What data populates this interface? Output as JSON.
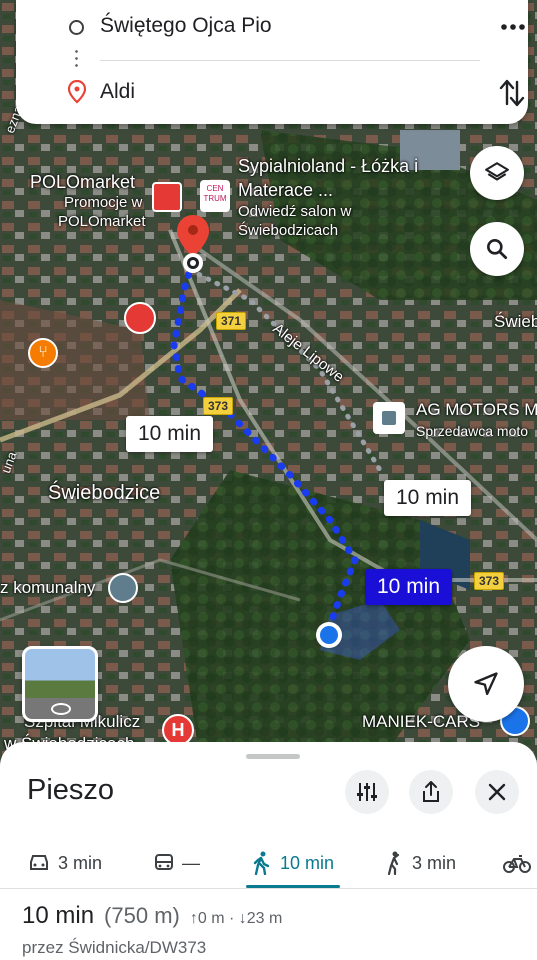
{
  "directions": {
    "origin": "Świętego Ojca Pio",
    "destination": "Aldi"
  },
  "map": {
    "places": {
      "polomarket_name": "POLOmarket",
      "polomarket_sub1": "Promocje w",
      "polomarket_sub2": "POLOmarket",
      "sypialnioland_1": "Sypialnioland - Łóżka i",
      "sypialnioland_2": "Materace ...",
      "sypialnioland_sub1": "Odwiedź salon w",
      "sypialnioland_sub2": "Świebodzicach",
      "centrum_logo": "CEN TRUM",
      "aleje": "Aleje Lipowe",
      "ag_motors": "AG MOTORS M",
      "ag_motors_sub": "Sprzedawca moto",
      "swiebodzice": "Świebodzice",
      "swieb_right": "Świeb",
      "komunalny": "z komunalny",
      "szpital_1": "Szpital Mikulicz",
      "szpital_2": "w Świebodzicach",
      "maniek": "MANIEK-CARS",
      "una": "una",
      "ezna": "ezna"
    },
    "roads": [
      "371",
      "373",
      "373"
    ],
    "time_bubbles": [
      "10 min",
      "10 min",
      "10 min"
    ],
    "colors": {
      "route": "#1a3cf0",
      "active_bubble": "#1a0fd6",
      "pin": "#ea4335"
    }
  },
  "sheet": {
    "title": "Pieszo",
    "modes": [
      {
        "icon": "car-icon",
        "label": "3 min"
      },
      {
        "icon": "transit-icon",
        "label": "—"
      },
      {
        "icon": "walk-icon",
        "label": "10 min",
        "active": true
      },
      {
        "icon": "rideshare-icon",
        "label": "3 min"
      },
      {
        "icon": "bike-icon",
        "label": ""
      }
    ],
    "summary": {
      "duration": "10 min",
      "distance": "(750 m)",
      "elevation_up": "0 m",
      "elevation_down": "23 m",
      "elevation_sep": "·",
      "via": "przez Świdnicka/DW373"
    },
    "accent": "#0b7a8f"
  }
}
